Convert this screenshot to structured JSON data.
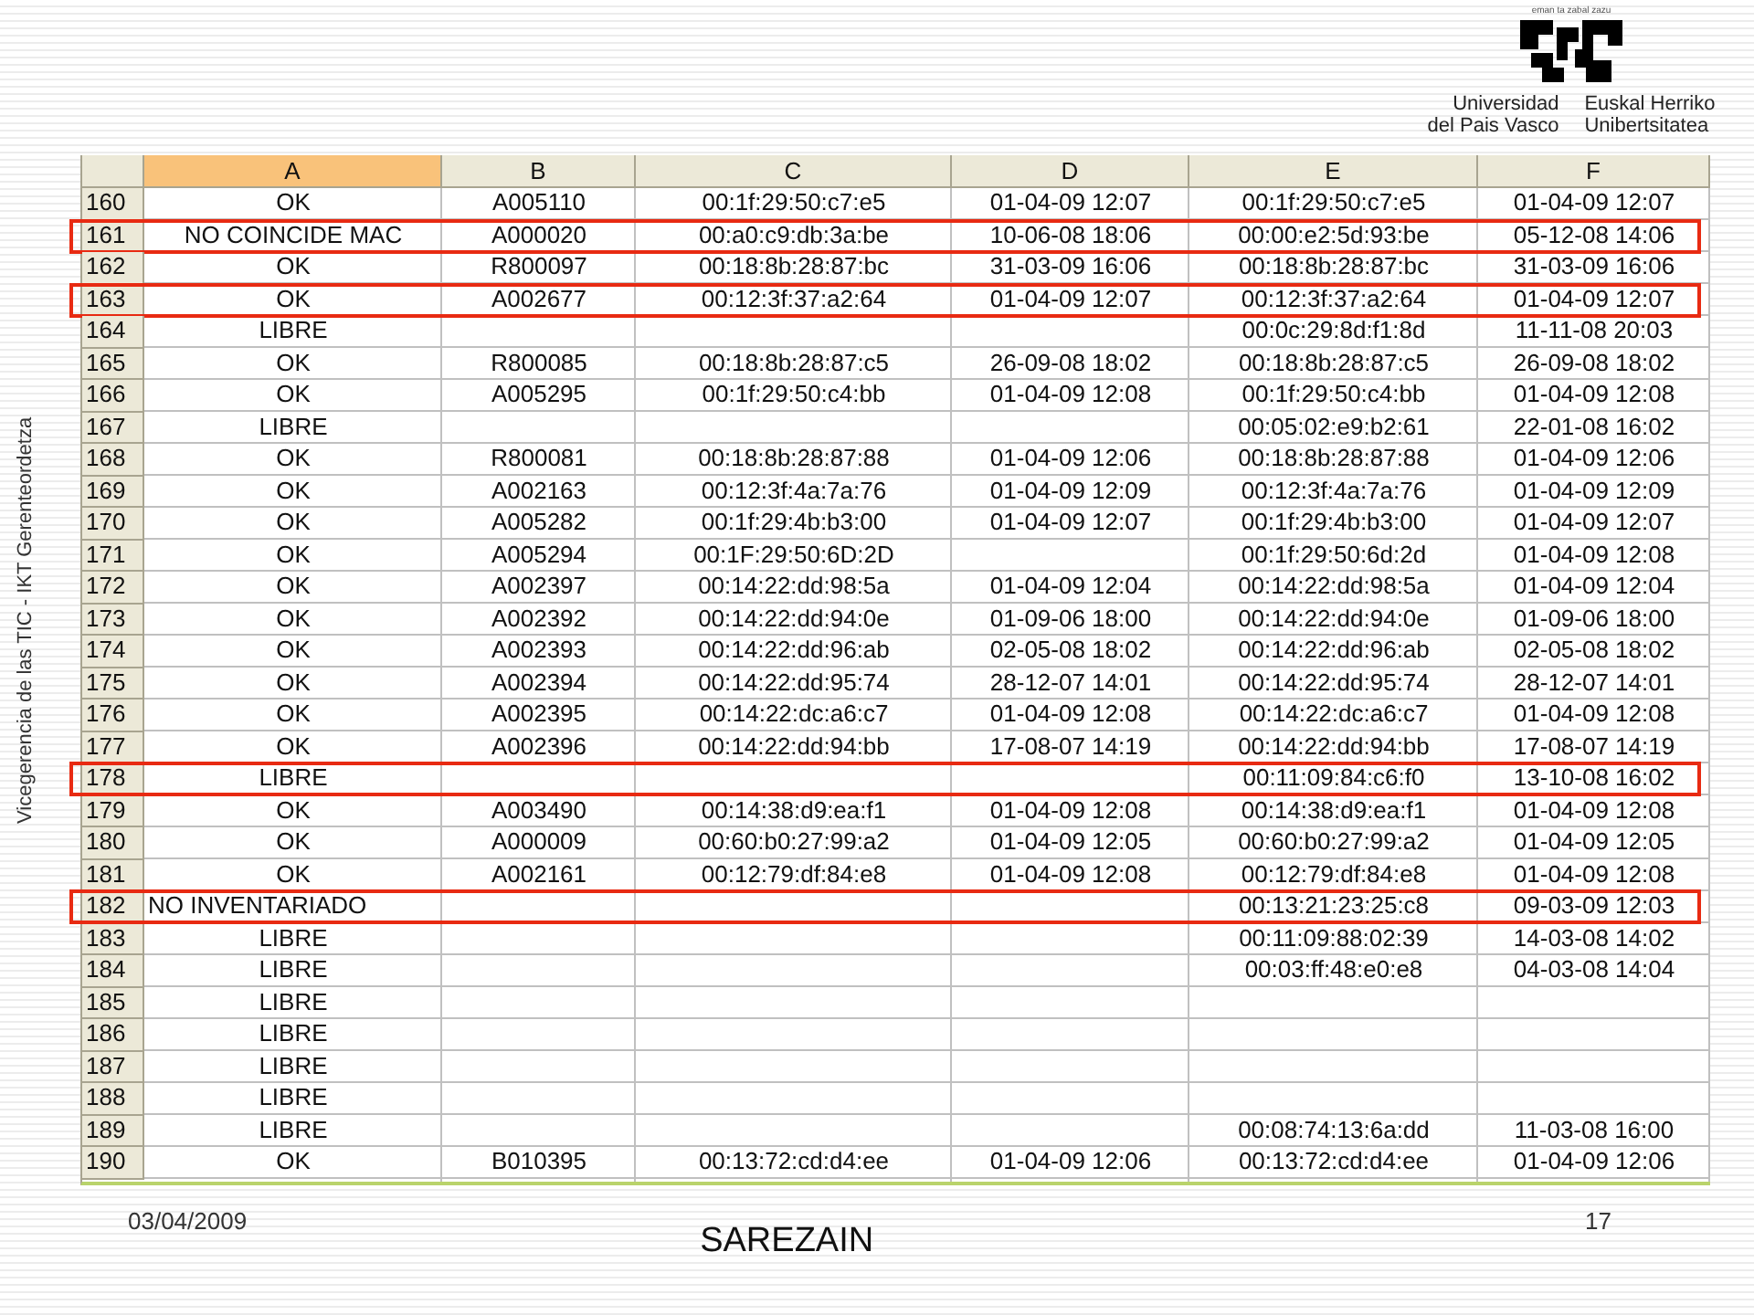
{
  "logo": {
    "motto": "eman ta zabal zazu",
    "name_es": [
      "Universidad",
      "del Pais Vasco"
    ],
    "name_eu": [
      "Euskal Herriko",
      "Unibertsitatea"
    ]
  },
  "side_text": "Vicegerencia de las TIC - IKT Gerenteordetza",
  "spreadsheet": {
    "columns": [
      {
        "label": "A",
        "selected": true
      },
      {
        "label": "B",
        "selected": false
      },
      {
        "label": "C",
        "selected": false
      },
      {
        "label": "D",
        "selected": false
      },
      {
        "label": "E",
        "selected": false
      },
      {
        "label": "F",
        "selected": false
      }
    ],
    "rows": [
      {
        "number": "160",
        "a": "OK",
        "b": "A005110",
        "c": "00:1f:29:50:c7:e5",
        "d": "01-04-09 12:07",
        "e": "00:1f:29:50:c7:e5",
        "f": "01-04-09 12:07",
        "left_aligned": false,
        "highlighted": false
      },
      {
        "number": "161",
        "a": "NO COINCIDE MAC",
        "b": "A000020",
        "c": "00:a0:c9:db:3a:be",
        "d": "10-06-08 18:06",
        "e": "00:00:e2:5d:93:be",
        "f": "05-12-08 14:06",
        "left_aligned": false,
        "highlighted": true
      },
      {
        "number": "162",
        "a": "OK",
        "b": "R800097",
        "c": "00:18:8b:28:87:bc",
        "d": "31-03-09 16:06",
        "e": "00:18:8b:28:87:bc",
        "f": "31-03-09 16:06",
        "left_aligned": false,
        "highlighted": false
      },
      {
        "number": "163",
        "a": "OK",
        "b": "A002677",
        "c": "00:12:3f:37:a2:64",
        "d": "01-04-09 12:07",
        "e": "00:12:3f:37:a2:64",
        "f": "01-04-09 12:07",
        "left_aligned": false,
        "highlighted": true
      },
      {
        "number": "164",
        "a": "LIBRE",
        "e": "00:0c:29:8d:f1:8d",
        "f": "11-11-08 20:03",
        "left_aligned": false,
        "highlighted": false
      },
      {
        "number": "165",
        "a": "OK",
        "b": "R800085",
        "c": "00:18:8b:28:87:c5",
        "d": "26-09-08 18:02",
        "e": "00:18:8b:28:87:c5",
        "f": "26-09-08 18:02",
        "left_aligned": false,
        "highlighted": false
      },
      {
        "number": "166",
        "a": "OK",
        "b": "A005295",
        "c": "00:1f:29:50:c4:bb",
        "d": "01-04-09 12:08",
        "e": "00:1f:29:50:c4:bb",
        "f": "01-04-09 12:08",
        "left_aligned": false,
        "highlighted": false
      },
      {
        "number": "167",
        "a": "LIBRE",
        "e": "00:05:02:e9:b2:61",
        "f": "22-01-08 16:02",
        "left_aligned": false,
        "highlighted": false
      },
      {
        "number": "168",
        "a": "OK",
        "b": "R800081",
        "c": "00:18:8b:28:87:88",
        "d": "01-04-09 12:06",
        "e": "00:18:8b:28:87:88",
        "f": "01-04-09 12:06",
        "left_aligned": false,
        "highlighted": false
      },
      {
        "number": "169",
        "a": "OK",
        "b": "A002163",
        "c": "00:12:3f:4a:7a:76",
        "d": "01-04-09 12:09",
        "e": "00:12:3f:4a:7a:76",
        "f": "01-04-09 12:09",
        "left_aligned": false,
        "highlighted": false
      },
      {
        "number": "170",
        "a": "OK",
        "b": "A005282",
        "c": "00:1f:29:4b:b3:00",
        "d": "01-04-09 12:07",
        "e": "00:1f:29:4b:b3:00",
        "f": "01-04-09 12:07",
        "left_aligned": false,
        "highlighted": false
      },
      {
        "number": "171",
        "a": "OK",
        "b": "A005294",
        "c": "00:1F:29:50:6D:2D",
        "e": "00:1f:29:50:6d:2d",
        "f": "01-04-09 12:08",
        "left_aligned": false,
        "highlighted": false
      },
      {
        "number": "172",
        "a": "OK",
        "b": "A002397",
        "c": "00:14:22:dd:98:5a",
        "d": "01-04-09 12:04",
        "e": "00:14:22:dd:98:5a",
        "f": "01-04-09 12:04",
        "left_aligned": false,
        "highlighted": false
      },
      {
        "number": "173",
        "a": "OK",
        "b": "A002392",
        "c": "00:14:22:dd:94:0e",
        "d": "01-09-06 18:00",
        "e": "00:14:22:dd:94:0e",
        "f": "01-09-06 18:00",
        "left_aligned": false,
        "highlighted": false
      },
      {
        "number": "174",
        "a": "OK",
        "b": "A002393",
        "c": "00:14:22:dd:96:ab",
        "d": "02-05-08 18:02",
        "e": "00:14:22:dd:96:ab",
        "f": "02-05-08 18:02",
        "left_aligned": false,
        "highlighted": false
      },
      {
        "number": "175",
        "a": "OK",
        "b": "A002394",
        "c": "00:14:22:dd:95:74",
        "d": "28-12-07 14:01",
        "e": "00:14:22:dd:95:74",
        "f": "28-12-07 14:01",
        "left_aligned": false,
        "highlighted": false
      },
      {
        "number": "176",
        "a": "OK",
        "b": "A002395",
        "c": "00:14:22:dc:a6:c7",
        "d": "01-04-09 12:08",
        "e": "00:14:22:dc:a6:c7",
        "f": "01-04-09 12:08",
        "left_aligned": false,
        "highlighted": false
      },
      {
        "number": "177",
        "a": "OK",
        "b": "A002396",
        "c": "00:14:22:dd:94:bb",
        "d": "17-08-07 14:19",
        "e": "00:14:22:dd:94:bb",
        "f": "17-08-07 14:19",
        "left_aligned": false,
        "highlighted": false
      },
      {
        "number": "178",
        "a": "LIBRE",
        "e": "00:11:09:84:c6:f0",
        "f": "13-10-08 16:02",
        "left_aligned": false,
        "highlighted": true
      },
      {
        "number": "179",
        "a": "OK",
        "b": "A003490",
        "c": "00:14:38:d9:ea:f1",
        "d": "01-04-09 12:08",
        "e": "00:14:38:d9:ea:f1",
        "f": "01-04-09 12:08",
        "left_aligned": false,
        "highlighted": false
      },
      {
        "number": "180",
        "a": "OK",
        "b": "A000009",
        "c": "00:60:b0:27:99:a2",
        "d": "01-04-09 12:05",
        "e": "00:60:b0:27:99:a2",
        "f": "01-04-09 12:05",
        "left_aligned": false,
        "highlighted": false
      },
      {
        "number": "181",
        "a": "OK",
        "b": "A002161",
        "c": "00:12:79:df:84:e8",
        "d": "01-04-09 12:08",
        "e": "00:12:79:df:84:e8",
        "f": "01-04-09 12:08",
        "left_aligned": false,
        "highlighted": false
      },
      {
        "number": "182",
        "a": "NO INVENTARIADO",
        "e": "00:13:21:23:25:c8",
        "f": "09-03-09 12:03",
        "left_aligned": true,
        "highlighted": true
      },
      {
        "number": "183",
        "a": "LIBRE",
        "e": "00:11:09:88:02:39",
        "f": "14-03-08 14:02",
        "left_aligned": false,
        "highlighted": false
      },
      {
        "number": "184",
        "a": "LIBRE",
        "e": "00:03:ff:48:e0:e8",
        "f": "04-03-08 14:04",
        "left_aligned": false,
        "highlighted": false
      },
      {
        "number": "185",
        "a": "LIBRE",
        "left_aligned": false,
        "highlighted": false
      },
      {
        "number": "186",
        "a": "LIBRE",
        "left_aligned": false,
        "highlighted": false
      },
      {
        "number": "187",
        "a": "LIBRE",
        "left_aligned": false,
        "highlighted": false
      },
      {
        "number": "188",
        "a": "LIBRE",
        "left_aligned": false,
        "highlighted": false
      },
      {
        "number": "189",
        "a": "LIBRE",
        "e": "00:08:74:13:6a:dd",
        "f": "11-03-08 16:00",
        "left_aligned": false,
        "highlighted": false
      },
      {
        "number": "190",
        "a": "OK",
        "b": "B010395",
        "c": "00:13:72:cd:d4:ee",
        "d": "01-04-09 12:06",
        "e": "00:13:72:cd:d4:ee",
        "f": "01-04-09 12:06",
        "left_aligned": false,
        "highlighted": false
      }
    ]
  },
  "footer": {
    "date": "03/04/2009",
    "title": "SAREZAIN",
    "page": "17"
  }
}
